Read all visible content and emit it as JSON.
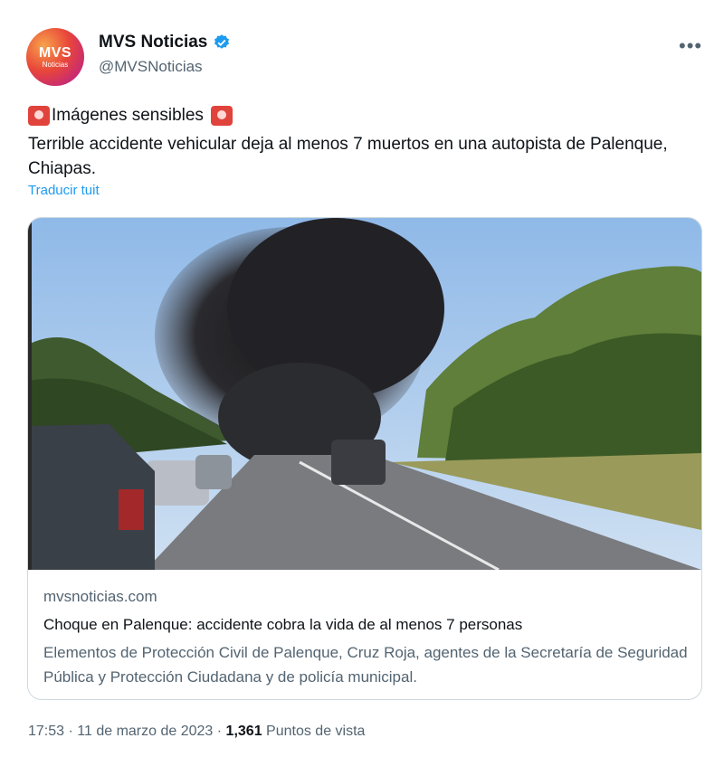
{
  "author": {
    "display_name": "MVS Noticias",
    "handle": "@MVSNoticias",
    "avatar_text": "MVS",
    "avatar_subtext": "Noticias",
    "verified": true
  },
  "tweet": {
    "line1": "Imágenes sensibles",
    "line2": "Terrible accidente vehicular deja al menos 7 muertos en una autopista de Palenque, Chiapas.",
    "translate_label": "Traducir tuit",
    "emoji_icon": "police-siren-icon"
  },
  "card": {
    "domain": "mvsnoticias.com",
    "title": "Choque en Palenque: accidente cobra la vida de al menos 7 personas",
    "description": "Elementos de Protección Civil de Palenque, Cruz Roja, agentes de la Secretaría de Seguridad Pública y Protección Ciudadana y de policía municipal."
  },
  "footer": {
    "time": "17:53",
    "sep": "·",
    "date": "11 de marzo de 2023",
    "views_count": "1,361",
    "views_label": "Puntos de vista"
  },
  "more_icon": "more-options-icon",
  "colors": {
    "link": "#1d9bf0",
    "muted": "#536471",
    "verified": "#1d9bf0"
  }
}
